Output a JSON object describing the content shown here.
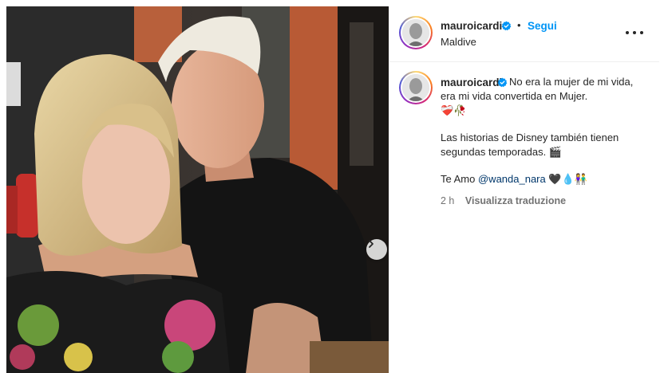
{
  "post": {
    "username": "mauroicardi",
    "verified": true,
    "separator": "•",
    "follow_label": "Segui",
    "location": "Maldive"
  },
  "caption": {
    "username": "mauroicardi",
    "line1": "No era la mujer de mi vida, era mi vida convertida en Mujer.",
    "line1_emoji": "❤️‍🩹🥀",
    "line2": "Las historias de Disney también tienen segundas temporadas. 🎬",
    "line3_prefix": "Te Amo",
    "mention": "@wanda_nara",
    "line3_suffix": "🖤💧👫"
  },
  "meta": {
    "time": "2 h",
    "translate_label": "Visualizza traduzione"
  },
  "icons": {
    "verified": "verified-badge-icon",
    "more": "more-options-icon",
    "next": "chevron-right-icon"
  },
  "colors": {
    "link": "#0095f6",
    "verified": "#0095f6",
    "mention": "#00376b",
    "secondary_text": "#737373",
    "ring": [
      "#feda75",
      "#fa7e1e",
      "#d62976",
      "#962fbf",
      "#4f5bd5"
    ]
  }
}
